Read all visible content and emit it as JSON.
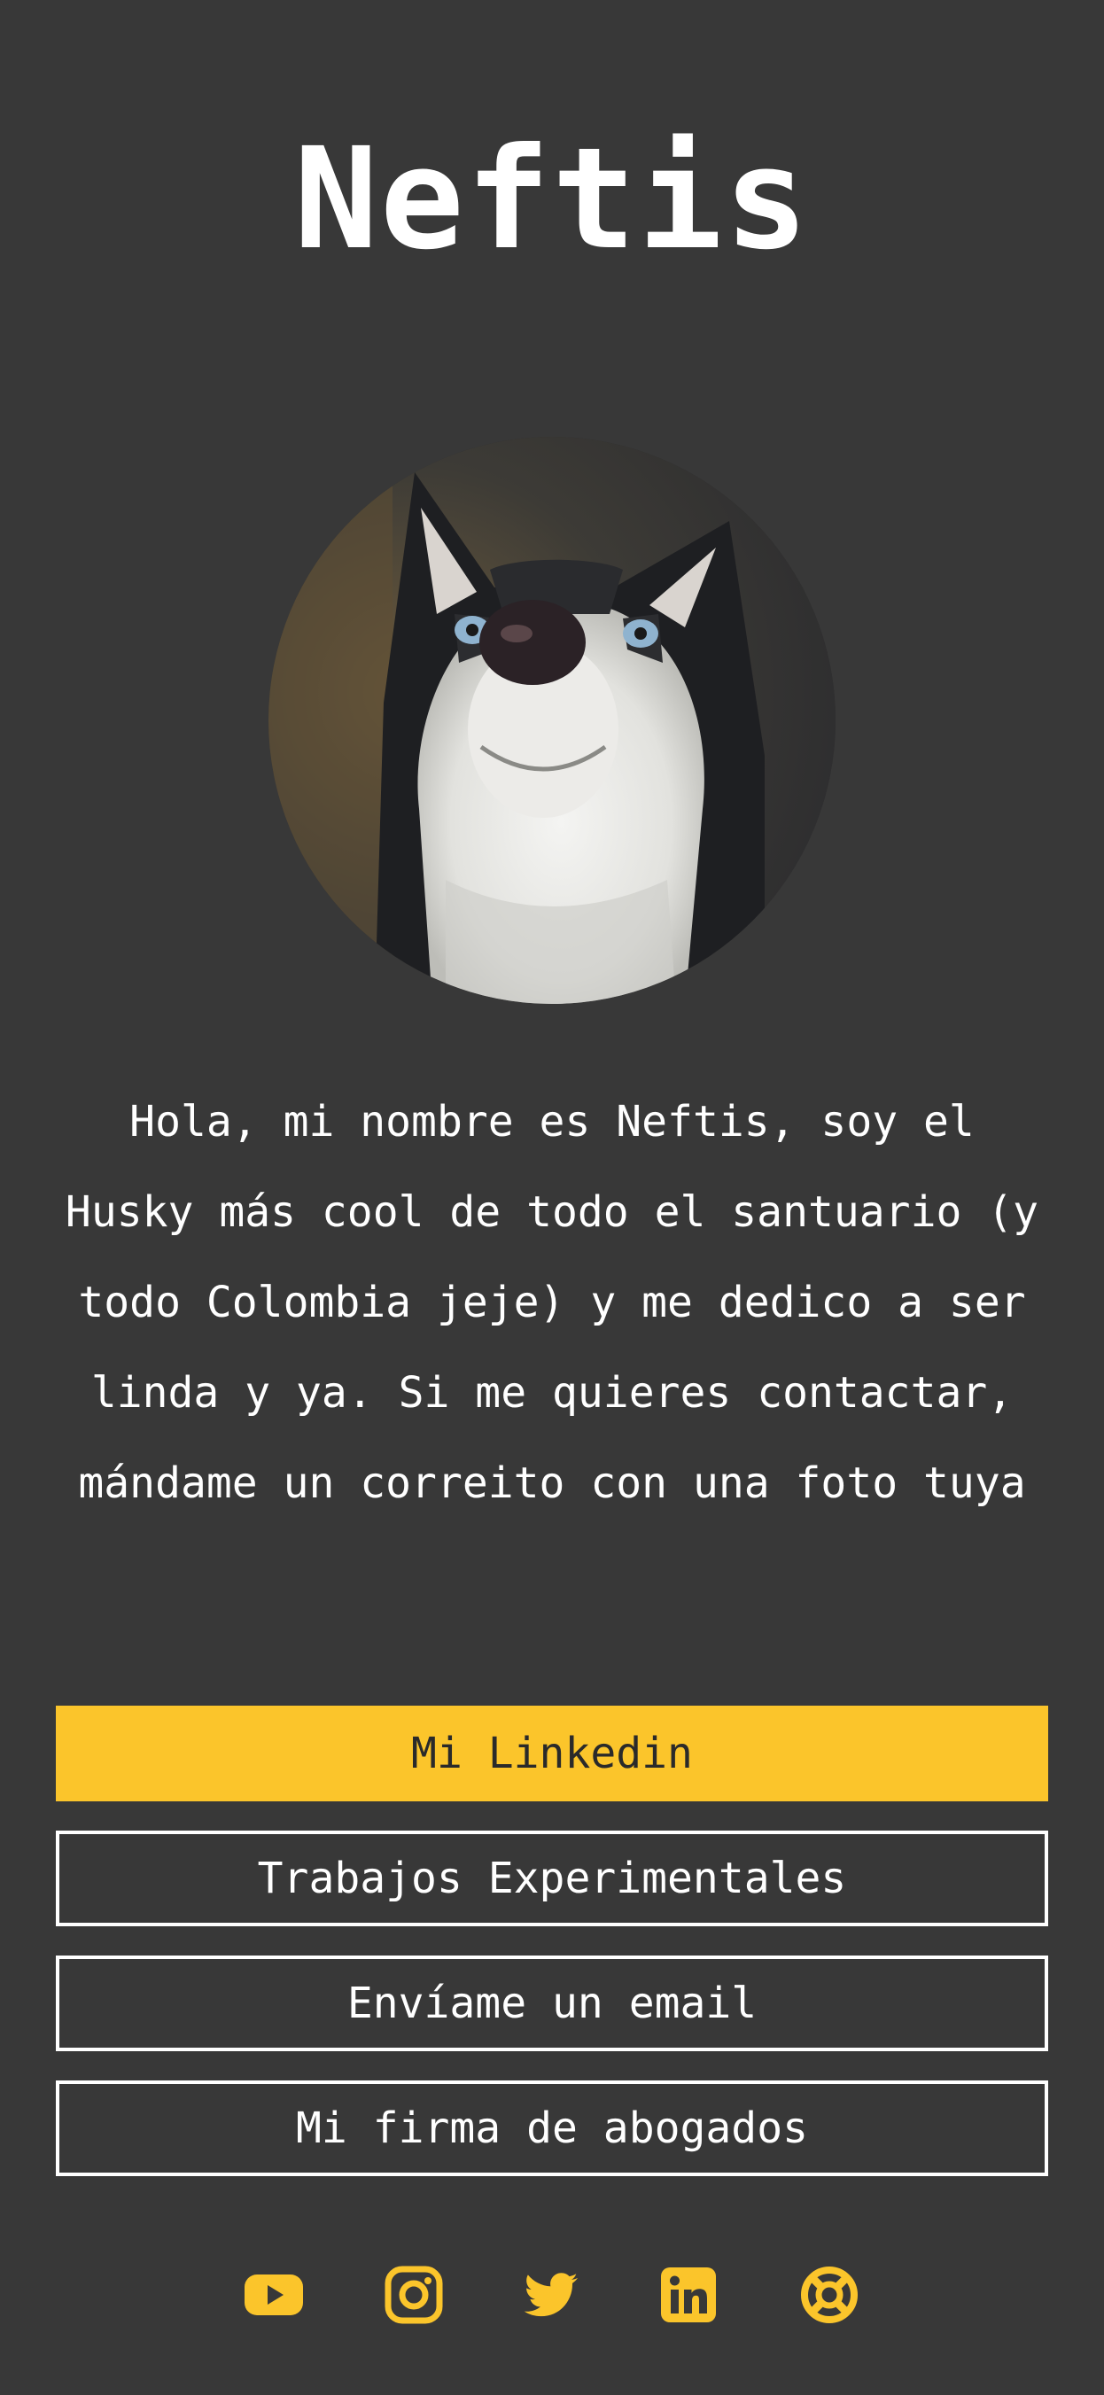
{
  "profile": {
    "name": "Neftis",
    "bio": "Hola, mi nombre es Neftis, soy el Husky más cool de todo el santuario (y todo Colombia jeje) y me dedico a ser linda y ya. Si me quieres contactar, mándame un correito con una foto tuya"
  },
  "links": [
    {
      "label": "Mi Linkedin",
      "style": "primary"
    },
    {
      "label": "Trabajos Experimentales",
      "style": "outline"
    },
    {
      "label": "Envíame un email",
      "style": "outline"
    },
    {
      "label": "Mi firma de abogados",
      "style": "outline"
    }
  ],
  "socials": [
    {
      "icon": "youtube-icon"
    },
    {
      "icon": "instagram-icon"
    },
    {
      "icon": "twitter-icon"
    },
    {
      "icon": "linkedin-icon"
    },
    {
      "icon": "lifebuoy-icon"
    }
  ],
  "colors": {
    "background": "#383838",
    "accent": "#fbc52b",
    "text": "#ffffff"
  }
}
